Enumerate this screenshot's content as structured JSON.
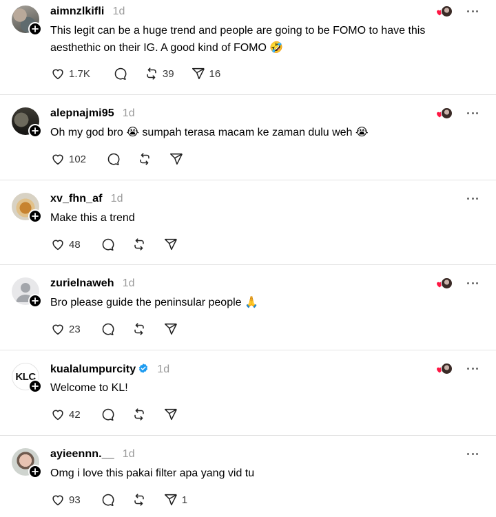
{
  "posts": [
    {
      "username": "aimnzlkifli",
      "time": "1d",
      "verified": false,
      "text": "This legit can be a huge trend and people are going to be FOMO to have this aesthethic on their IG. A good kind of FOMO 🤣",
      "likes": "1.7K",
      "replies": "",
      "reposts": "39",
      "shares": "16",
      "author_liked": true
    },
    {
      "username": "alepnajmi95",
      "time": "1d",
      "verified": false,
      "text": "Oh my god bro 😭 sumpah terasa macam ke zaman dulu weh 😭",
      "likes": "102",
      "replies": "",
      "reposts": "",
      "shares": "",
      "author_liked": true
    },
    {
      "username": "xv_fhn_af",
      "time": "1d",
      "verified": false,
      "text": "Make this a trend",
      "likes": "48",
      "replies": "",
      "reposts": "",
      "shares": "",
      "author_liked": false
    },
    {
      "username": "zurielnaweh",
      "time": "1d",
      "verified": false,
      "text": "Bro please guide the peninsular people 🙏",
      "likes": "23",
      "replies": "",
      "reposts": "",
      "shares": "",
      "author_liked": true
    },
    {
      "username": "kualalumpurcity",
      "time": "1d",
      "verified": true,
      "avatar_text": "KLC",
      "text": "Welcome to KL!",
      "likes": "42",
      "replies": "",
      "reposts": "",
      "shares": "",
      "author_liked": true
    },
    {
      "username": "ayieennn.__",
      "time": "1d",
      "verified": false,
      "text": "Omg i love this pakai filter apa yang vid tu",
      "likes": "93",
      "replies": "",
      "reposts": "",
      "shares": "1",
      "author_liked": false
    }
  ],
  "icons": {
    "like": "heart-outline-icon",
    "reply": "comment-bubble-icon",
    "repost": "repost-arrows-icon",
    "share": "send-paper-plane-icon",
    "more": "more-horizontal-icon",
    "follow": "plus-icon",
    "verified": "verified-badge-icon"
  },
  "colors": {
    "verified": "#1d9bf0",
    "liked_heart": "#ff1744",
    "timestamp": "#9a9a9a",
    "separator": "#e2e2e2"
  }
}
